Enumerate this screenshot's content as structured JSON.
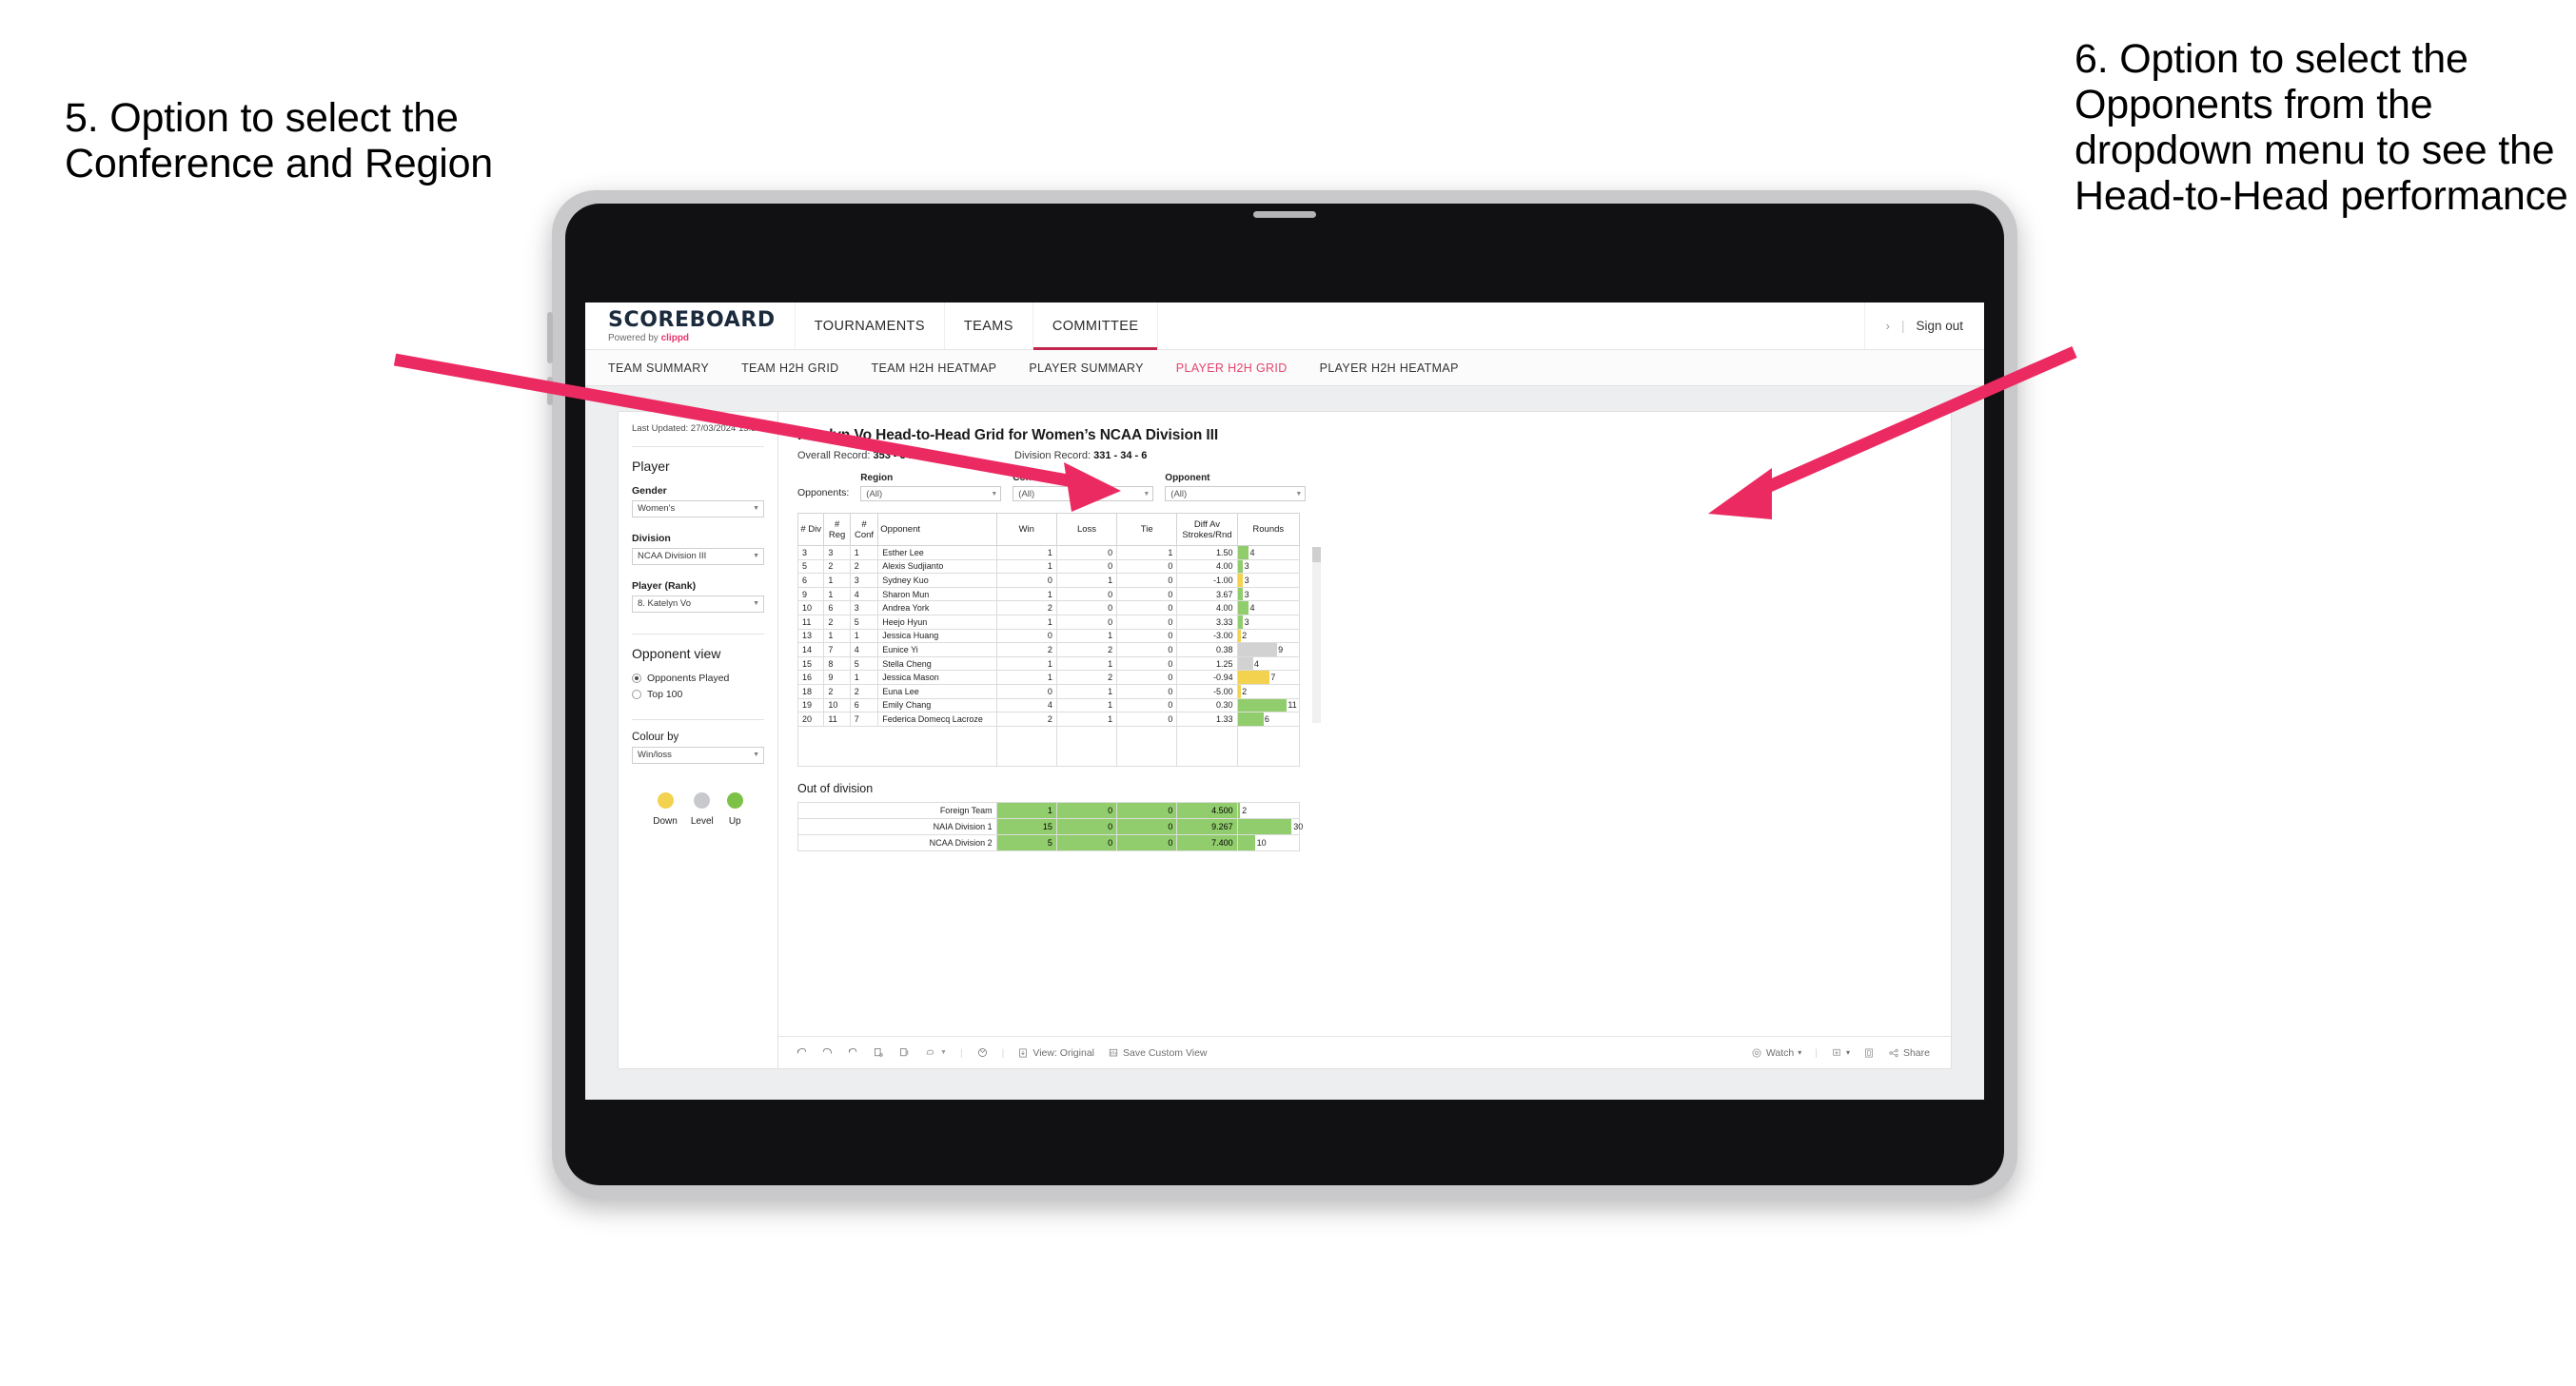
{
  "annotations": {
    "left": "5. Option to select the Conference and Region",
    "right": "6. Option to select the Opponents from the dropdown menu to see the Head-to-Head performance"
  },
  "colors": {
    "accent": "#e5436f",
    "active_tab_underline": "#c2254e",
    "up_green": "#92cd6d",
    "level_grey": "#d2d2d2",
    "down_yellow": "#f2d24f",
    "arrow_pink": "#ec2a62"
  },
  "brand": {
    "title": "SCOREBOARD",
    "powered_prefix": "Powered by ",
    "powered_name": "clippd"
  },
  "topnav": {
    "tabs": [
      {
        "label": "TOURNAMENTS",
        "active": false
      },
      {
        "label": "TEAMS",
        "active": false
      },
      {
        "label": "COMMITTEE",
        "active": true
      }
    ],
    "chevron": "›",
    "divider": "|",
    "sign_out": "Sign out"
  },
  "subnav": {
    "tabs": [
      {
        "label": "TEAM SUMMARY",
        "active": false
      },
      {
        "label": "TEAM H2H GRID",
        "active": false
      },
      {
        "label": "TEAM H2H HEATMAP",
        "active": false
      },
      {
        "label": "PLAYER SUMMARY",
        "active": false
      },
      {
        "label": "PLAYER H2H GRID",
        "active": true
      },
      {
        "label": "PLAYER H2H HEATMAP",
        "active": false
      }
    ]
  },
  "sidebar": {
    "last_updated": "Last Updated: 27/03/2024 15:38",
    "player_section": "Player",
    "gender_label": "Gender",
    "gender_value": "Women’s",
    "division_label": "Division",
    "division_value": "NCAA Division III",
    "player_rank_label": "Player (Rank)",
    "player_rank_value": "8. Katelyn Vo",
    "opponent_view_title": "Opponent view",
    "opponent_view_options": [
      {
        "label": "Opponents Played",
        "selected": true
      },
      {
        "label": "Top 100",
        "selected": false
      }
    ],
    "colour_by_label": "Colour by",
    "colour_by_value": "Win/loss",
    "legend": [
      {
        "label": "Down",
        "color": "#f2d24f"
      },
      {
        "label": "Level",
        "color": "#c7c9cc"
      },
      {
        "label": "Up",
        "color": "#7dc246"
      }
    ]
  },
  "main": {
    "title": "Katelyn Vo Head-to-Head Grid for Women’s NCAA Division III",
    "overall_record_label": "Overall Record: ",
    "overall_record_value": "353 - 34 - 6",
    "division_record_label": "Division Record: ",
    "division_record_value": "331 - 34 - 6",
    "opponents_label": "Opponents:",
    "filters": [
      {
        "label": "Region",
        "value": "(All)"
      },
      {
        "label": "Conference",
        "value": "(All)"
      },
      {
        "label": "Opponent",
        "value": "(All)"
      }
    ],
    "table_headers": {
      "div": "# Div",
      "reg": "# Reg",
      "conf": "# Conf",
      "opponent": "Opponent",
      "win": "Win",
      "loss": "Loss",
      "tie": "Tie",
      "diff": "Diff Av Strokes/Rnd",
      "rounds": "Rounds"
    },
    "rows": [
      {
        "div": "3",
        "reg": "3",
        "conf": "1",
        "opponent": "Esther Lee",
        "win": "1",
        "loss": "0",
        "tie": "1",
        "diff": "1.50",
        "rounds": "4",
        "color": "g",
        "bar_pct": 18
      },
      {
        "div": "5",
        "reg": "2",
        "conf": "2",
        "opponent": "Alexis Sudjianto",
        "win": "1",
        "loss": "0",
        "tie": "0",
        "diff": "4.00",
        "rounds": "3",
        "color": "g",
        "bar_pct": 9
      },
      {
        "div": "6",
        "reg": "1",
        "conf": "3",
        "opponent": "Sydney Kuo",
        "win": "0",
        "loss": "1",
        "tie": "0",
        "diff": "-1.00",
        "rounds": "3",
        "color": "y",
        "bar_pct": 9
      },
      {
        "div": "9",
        "reg": "1",
        "conf": "4",
        "opponent": "Sharon Mun",
        "win": "1",
        "loss": "0",
        "tie": "0",
        "diff": "3.67",
        "rounds": "3",
        "color": "g",
        "bar_pct": 9
      },
      {
        "div": "10",
        "reg": "6",
        "conf": "3",
        "opponent": "Andrea York",
        "win": "2",
        "loss": "0",
        "tie": "0",
        "diff": "4.00",
        "rounds": "4",
        "color": "g",
        "bar_pct": 18
      },
      {
        "div": "11",
        "reg": "2",
        "conf": "5",
        "opponent": "Heejo Hyun",
        "win": "1",
        "loss": "0",
        "tie": "0",
        "diff": "3.33",
        "rounds": "3",
        "color": "g",
        "bar_pct": 9
      },
      {
        "div": "13",
        "reg": "1",
        "conf": "1",
        "opponent": "Jessica Huang",
        "win": "0",
        "loss": "1",
        "tie": "0",
        "diff": "-3.00",
        "rounds": "2",
        "color": "y",
        "bar_pct": 5
      },
      {
        "div": "14",
        "reg": "7",
        "conf": "4",
        "opponent": "Eunice Yi",
        "win": "2",
        "loss": "2",
        "tie": "0",
        "diff": "0.38",
        "rounds": "9",
        "color": "gr",
        "bar_pct": 64,
        "diff_color": "g"
      },
      {
        "div": "15",
        "reg": "8",
        "conf": "5",
        "opponent": "Stella Cheng",
        "win": "1",
        "loss": "1",
        "tie": "0",
        "diff": "1.25",
        "rounds": "4",
        "color": "gr",
        "bar_pct": 25,
        "diff_color": "g"
      },
      {
        "div": "16",
        "reg": "9",
        "conf": "1",
        "opponent": "Jessica Mason",
        "win": "1",
        "loss": "2",
        "tie": "0",
        "diff": "-0.94",
        "rounds": "7",
        "color": "y",
        "bar_pct": 52
      },
      {
        "div": "18",
        "reg": "2",
        "conf": "2",
        "opponent": "Euna Lee",
        "win": "0",
        "loss": "1",
        "tie": "0",
        "diff": "-5.00",
        "rounds": "2",
        "color": "y",
        "bar_pct": 5
      },
      {
        "div": "19",
        "reg": "10",
        "conf": "6",
        "opponent": "Emily Chang",
        "win": "4",
        "loss": "1",
        "tie": "0",
        "diff": "0.30",
        "rounds": "11",
        "color": "g",
        "bar_pct": 80
      },
      {
        "div": "20",
        "reg": "11",
        "conf": "7",
        "opponent": "Federica Domecq Lacroze",
        "win": "2",
        "loss": "1",
        "tie": "0",
        "diff": "1.33",
        "rounds": "6",
        "color": "g",
        "bar_pct": 42
      }
    ],
    "out_of_division_title": "Out of division",
    "out_of_division_rows": [
      {
        "name": "Foreign Team",
        "win": "1",
        "loss": "0",
        "tie": "0",
        "diff": "4.500",
        "rounds": "2",
        "color": "g",
        "bar_pct": 4
      },
      {
        "name": "NAIA Division 1",
        "win": "15",
        "loss": "0",
        "tie": "0",
        "diff": "9.267",
        "rounds": "30",
        "color": "g",
        "bar_pct": 88
      },
      {
        "name": "NCAA Division 2",
        "win": "5",
        "loss": "0",
        "tie": "0",
        "diff": "7.400",
        "rounds": "10",
        "color": "g",
        "bar_pct": 28
      }
    ]
  },
  "toolbar": {
    "view_label": "View: Original",
    "save_label": "Save Custom View",
    "watch_label": "Watch",
    "share_label": "Share",
    "caret": "▾",
    "divider": "|"
  }
}
